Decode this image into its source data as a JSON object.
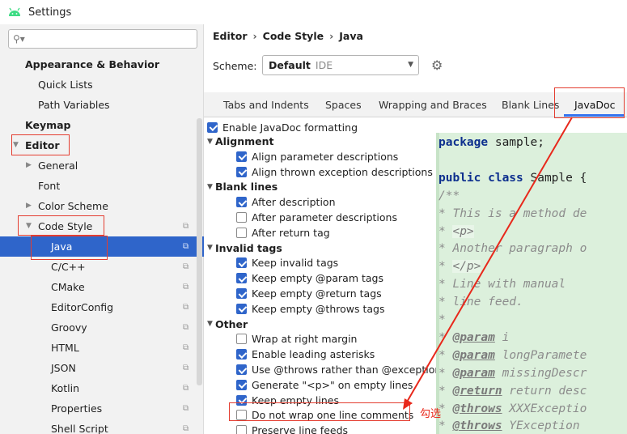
{
  "window": {
    "title": "Settings"
  },
  "sidebar": {
    "items": [
      {
        "label": "Appearance & Behavior",
        "bold": true,
        "arrow": "",
        "copy": false,
        "selected": false,
        "indent": 31
      },
      {
        "label": "Quick Lists",
        "bold": false,
        "arrow": "",
        "copy": false,
        "selected": false,
        "indent": 47
      },
      {
        "label": "Path Variables",
        "bold": false,
        "arrow": "",
        "copy": false,
        "selected": false,
        "indent": 47
      },
      {
        "label": "Keymap",
        "bold": true,
        "arrow": "",
        "copy": false,
        "selected": false,
        "indent": 31
      },
      {
        "label": "Editor",
        "bold": true,
        "arrow": "▼",
        "copy": false,
        "selected": false,
        "indent": 31
      },
      {
        "label": "General",
        "bold": false,
        "arrow": "▶",
        "copy": false,
        "selected": false,
        "indent": 47
      },
      {
        "label": "Font",
        "bold": false,
        "arrow": "",
        "copy": false,
        "selected": false,
        "indent": 47
      },
      {
        "label": "Color Scheme",
        "bold": false,
        "arrow": "▶",
        "copy": false,
        "selected": false,
        "indent": 47
      },
      {
        "label": "Code Style",
        "bold": false,
        "arrow": "▼",
        "copy": true,
        "selected": false,
        "indent": 47
      },
      {
        "label": "Java",
        "bold": false,
        "arrow": "",
        "copy": true,
        "selected": true,
        "indent": 63
      },
      {
        "label": "C/C++",
        "bold": false,
        "arrow": "",
        "copy": true,
        "selected": false,
        "indent": 63
      },
      {
        "label": "CMake",
        "bold": false,
        "arrow": "",
        "copy": true,
        "selected": false,
        "indent": 63
      },
      {
        "label": "EditorConfig",
        "bold": false,
        "arrow": "",
        "copy": true,
        "selected": false,
        "indent": 63
      },
      {
        "label": "Groovy",
        "bold": false,
        "arrow": "",
        "copy": true,
        "selected": false,
        "indent": 63
      },
      {
        "label": "HTML",
        "bold": false,
        "arrow": "",
        "copy": true,
        "selected": false,
        "indent": 63
      },
      {
        "label": "JSON",
        "bold": false,
        "arrow": "",
        "copy": true,
        "selected": false,
        "indent": 63
      },
      {
        "label": "Kotlin",
        "bold": false,
        "arrow": "",
        "copy": true,
        "selected": false,
        "indent": 63
      },
      {
        "label": "Properties",
        "bold": false,
        "arrow": "",
        "copy": true,
        "selected": false,
        "indent": 63
      },
      {
        "label": "Shell Script",
        "bold": false,
        "arrow": "",
        "copy": true,
        "selected": false,
        "indent": 63
      }
    ]
  },
  "breadcrumb": [
    "Editor",
    "Code Style",
    "Java"
  ],
  "scheme": {
    "label": "Scheme:",
    "value": "Default",
    "suffix": "IDE"
  },
  "tabs": [
    "Tabs and Indents",
    "Spaces",
    "Wrapping and Braces",
    "Blank Lines",
    "JavaDoc"
  ],
  "active_tab": "JavaDoc",
  "enable_javadoc": {
    "label": "Enable JavaDoc formatting",
    "checked": true
  },
  "options": [
    {
      "type": "group",
      "label": "Alignment"
    },
    {
      "type": "item",
      "label": "Align parameter descriptions",
      "checked": true
    },
    {
      "type": "item",
      "label": "Align thrown exception descriptions",
      "checked": true
    },
    {
      "type": "group",
      "label": "Blank lines"
    },
    {
      "type": "item",
      "label": "After description",
      "checked": true
    },
    {
      "type": "item",
      "label": "After parameter descriptions",
      "checked": false
    },
    {
      "type": "item",
      "label": "After return tag",
      "checked": false
    },
    {
      "type": "group",
      "label": "Invalid tags"
    },
    {
      "type": "item",
      "label": "Keep invalid tags",
      "checked": true
    },
    {
      "type": "item",
      "label": "Keep empty @param tags",
      "checked": true
    },
    {
      "type": "item",
      "label": "Keep empty @return tags",
      "checked": true
    },
    {
      "type": "item",
      "label": "Keep empty @throws tags",
      "checked": true
    },
    {
      "type": "group",
      "label": "Other"
    },
    {
      "type": "item",
      "label": "Wrap at right margin",
      "checked": false
    },
    {
      "type": "item",
      "label": "Enable leading asterisks",
      "checked": true
    },
    {
      "type": "item",
      "label": "Use @throws rather than @exception",
      "checked": true
    },
    {
      "type": "item",
      "label": "Generate \"<p>\" on empty lines",
      "checked": true
    },
    {
      "type": "item",
      "label": "Keep empty lines",
      "checked": true
    },
    {
      "type": "item",
      "label": "Do not wrap one line comments",
      "checked": false
    },
    {
      "type": "item",
      "label": "Preserve line feeds",
      "checked": false
    }
  ],
  "preview": {
    "lines": [
      [
        {
          "t": "package",
          "c": "kw"
        },
        {
          "t": " sample;",
          "c": ""
        }
      ],
      [],
      [
        {
          "t": "public class",
          "c": "kw"
        },
        {
          "t": " Sample {",
          "c": ""
        }
      ],
      [
        {
          "t": "    /**",
          "c": "cm"
        }
      ],
      [
        {
          "t": "     * This is a method de",
          "c": "cm"
        }
      ],
      [
        {
          "t": "     * ",
          "c": "cm"
        },
        {
          "t": "<p>",
          "c": "tag"
        }
      ],
      [
        {
          "t": "     * Another paragraph o",
          "c": "cm"
        }
      ],
      [
        {
          "t": "     * ",
          "c": "cm"
        },
        {
          "t": "</p>",
          "c": "tag"
        }
      ],
      [
        {
          "t": "     * Line with manual",
          "c": "cm"
        }
      ],
      [
        {
          "t": "     * line feed.",
          "c": "cm"
        }
      ],
      [
        {
          "t": "     *",
          "c": "cm"
        }
      ],
      [
        {
          "t": "     * ",
          "c": "cm"
        },
        {
          "t": "@param",
          "c": "jdt"
        },
        {
          "t": " i",
          "c": "cm"
        }
      ],
      [
        {
          "t": "     * ",
          "c": "cm"
        },
        {
          "t": "@param",
          "c": "jdt"
        },
        {
          "t": " longParamete",
          "c": "cm"
        }
      ],
      [
        {
          "t": "     * ",
          "c": "cm"
        },
        {
          "t": "@param",
          "c": "jdt"
        },
        {
          "t": " missingDescr",
          "c": "cm"
        }
      ],
      [
        {
          "t": "     * ",
          "c": "cm"
        },
        {
          "t": "@return",
          "c": "jdt"
        },
        {
          "t": " return desc",
          "c": "cm"
        }
      ],
      [
        {
          "t": "     * ",
          "c": "cm"
        },
        {
          "t": "@throws",
          "c": "jdt"
        },
        {
          "t": " XXXExceptio",
          "c": "cm"
        }
      ],
      [
        {
          "t": "     * ",
          "c": "cm"
        },
        {
          "t": "@throws",
          "c": "jdt"
        },
        {
          "t": " YException",
          "c": "cm"
        }
      ]
    ]
  },
  "annotation": {
    "text": "勾选"
  },
  "colors": {
    "accent": "#2f65ca",
    "highlight": "#e43d30",
    "preview_bg": "#dcf0dc"
  }
}
